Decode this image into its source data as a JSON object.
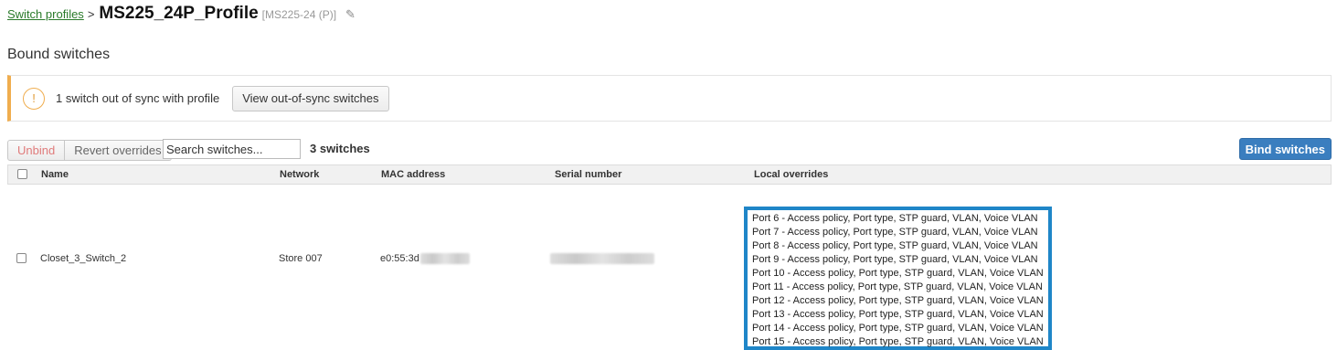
{
  "breadcrumb": {
    "parent": "Switch profiles",
    "separator": ">",
    "title": "MS225_24P_Profile",
    "model": "[MS225-24 (P)]"
  },
  "section_title": "Bound switches",
  "alert": {
    "message": "1 switch out of sync with profile",
    "button": "View out-of-sync switches"
  },
  "toolbar": {
    "unbind": "Unbind",
    "revert": "Revert overrides",
    "search_placeholder": "Search switches...",
    "count": "3 switches",
    "bind": "Bind switches"
  },
  "table": {
    "columns": [
      "Name",
      "Network",
      "MAC address",
      "Serial number",
      "Local overrides"
    ],
    "rows": [
      {
        "name": "Closet_3_Switch_2",
        "network": "Store 007",
        "mac": "e0:55:3d",
        "serial": "",
        "overrides": [
          "Port 6 - Access policy, Port type, STP guard, VLAN, Voice VLAN",
          "Port 7 - Access policy, Port type, STP guard, VLAN, Voice VLAN",
          "Port 8 - Access policy, Port type, STP guard, VLAN, Voice VLAN",
          "Port 9 - Access policy, Port type, STP guard, VLAN, Voice VLAN",
          "Port 10 - Access policy, Port type, STP guard, VLAN, Voice VLAN",
          "Port 11 - Access policy, Port type, STP guard, VLAN, Voice VLAN",
          "Port 12 - Access policy, Port type, STP guard, VLAN, Voice VLAN",
          "Port 13 - Access policy, Port type, STP guard, VLAN, Voice VLAN",
          "Port 14 - Access policy, Port type, STP guard, VLAN, Voice VLAN",
          "Port 15 - Access policy, Port type, STP guard, VLAN, Voice VLAN"
        ]
      }
    ]
  },
  "icons": {
    "alert": "warning-circle-icon",
    "edit": "pencil-icon"
  },
  "colors": {
    "warning": "#f0ad4e",
    "primary": "#3a7ebf",
    "highlight": "#1f86c8",
    "link": "#2a7a2a"
  }
}
